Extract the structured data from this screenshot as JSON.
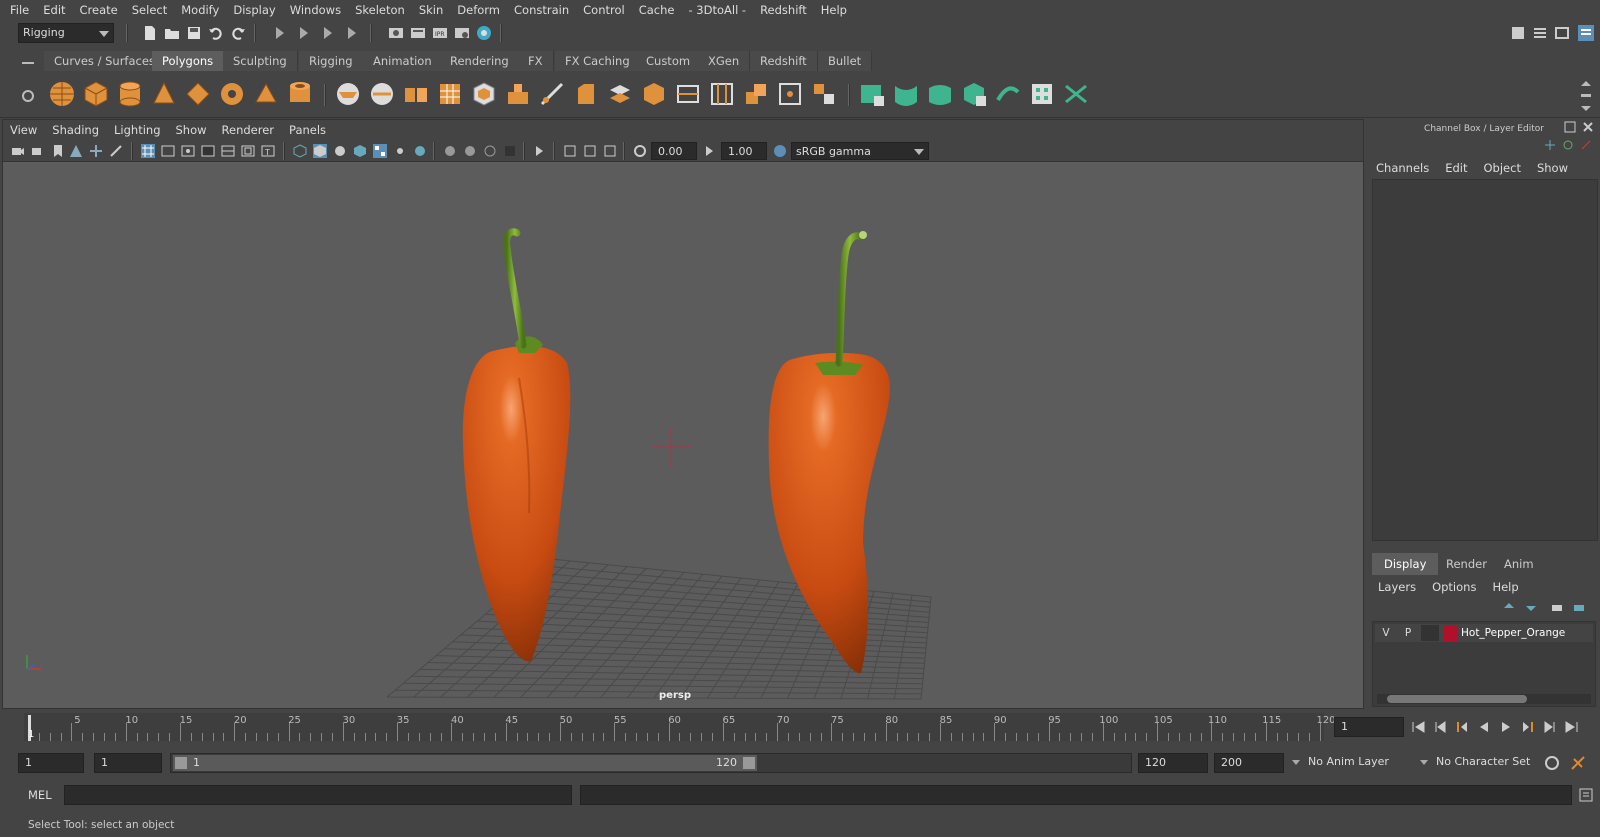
{
  "menubar": {
    "items": [
      "File",
      "Edit",
      "Create",
      "Select",
      "Modify",
      "Display",
      "Windows",
      "Skeleton",
      "Skin",
      "Deform",
      "Constrain",
      "Control",
      "Cache",
      "- 3DtoAll -",
      "Redshift",
      "Help"
    ]
  },
  "statusline": {
    "menuset": "Rigging"
  },
  "shelf": {
    "tabs": [
      "Curves / Surfaces",
      "Polygons",
      "Sculpting",
      "Rigging",
      "Animation",
      "Rendering",
      "FX",
      "FX Caching",
      "Custom",
      "XGen",
      "Redshift",
      "Bullet"
    ],
    "active_tab": "Polygons"
  },
  "viewport": {
    "menu": [
      "View",
      "Shading",
      "Lighting",
      "Show",
      "Renderer",
      "Panels"
    ],
    "exposure": "0.00",
    "gamma": "1.00",
    "color_space": "sRGB gamma",
    "camera_label": "persp"
  },
  "channel_box": {
    "title": "Channel Box / Layer Editor",
    "menu": [
      "Channels",
      "Edit",
      "Object",
      "Show"
    ]
  },
  "layer_editor": {
    "tabs": [
      "Display",
      "Render",
      "Anim"
    ],
    "active_tab": "Display",
    "menu": [
      "Layers",
      "Options",
      "Help"
    ],
    "layers": [
      {
        "visible": "V",
        "playback": "P",
        "name": "Hot_Pepper_Orange",
        "color": "#b0102a"
      }
    ]
  },
  "timeline": {
    "ticks": [
      "5",
      "10",
      "15",
      "20",
      "25",
      "30",
      "35",
      "40",
      "45",
      "50",
      "55",
      "60",
      "65",
      "70",
      "75",
      "80",
      "85",
      "90",
      "95",
      "100",
      "105",
      "110",
      "115",
      "120"
    ],
    "current_marker": "1",
    "current_frame": "1"
  },
  "range": {
    "start": "1",
    "playback_start": "1",
    "slider_start": "1",
    "slider_end": "120",
    "playback_end": "120",
    "end": "200",
    "anim_layer": "No Anim Layer",
    "character_set": "No Character Set"
  },
  "commandline": {
    "label": "MEL"
  },
  "helpline": {
    "text": "Select Tool: select an object"
  },
  "colors": {
    "pepper": "#d9561a",
    "stem": "#6d9a2a",
    "accent": "#5d5d5d",
    "shelf_orange": "#e0913c",
    "shelf_green": "#3fb58f"
  }
}
